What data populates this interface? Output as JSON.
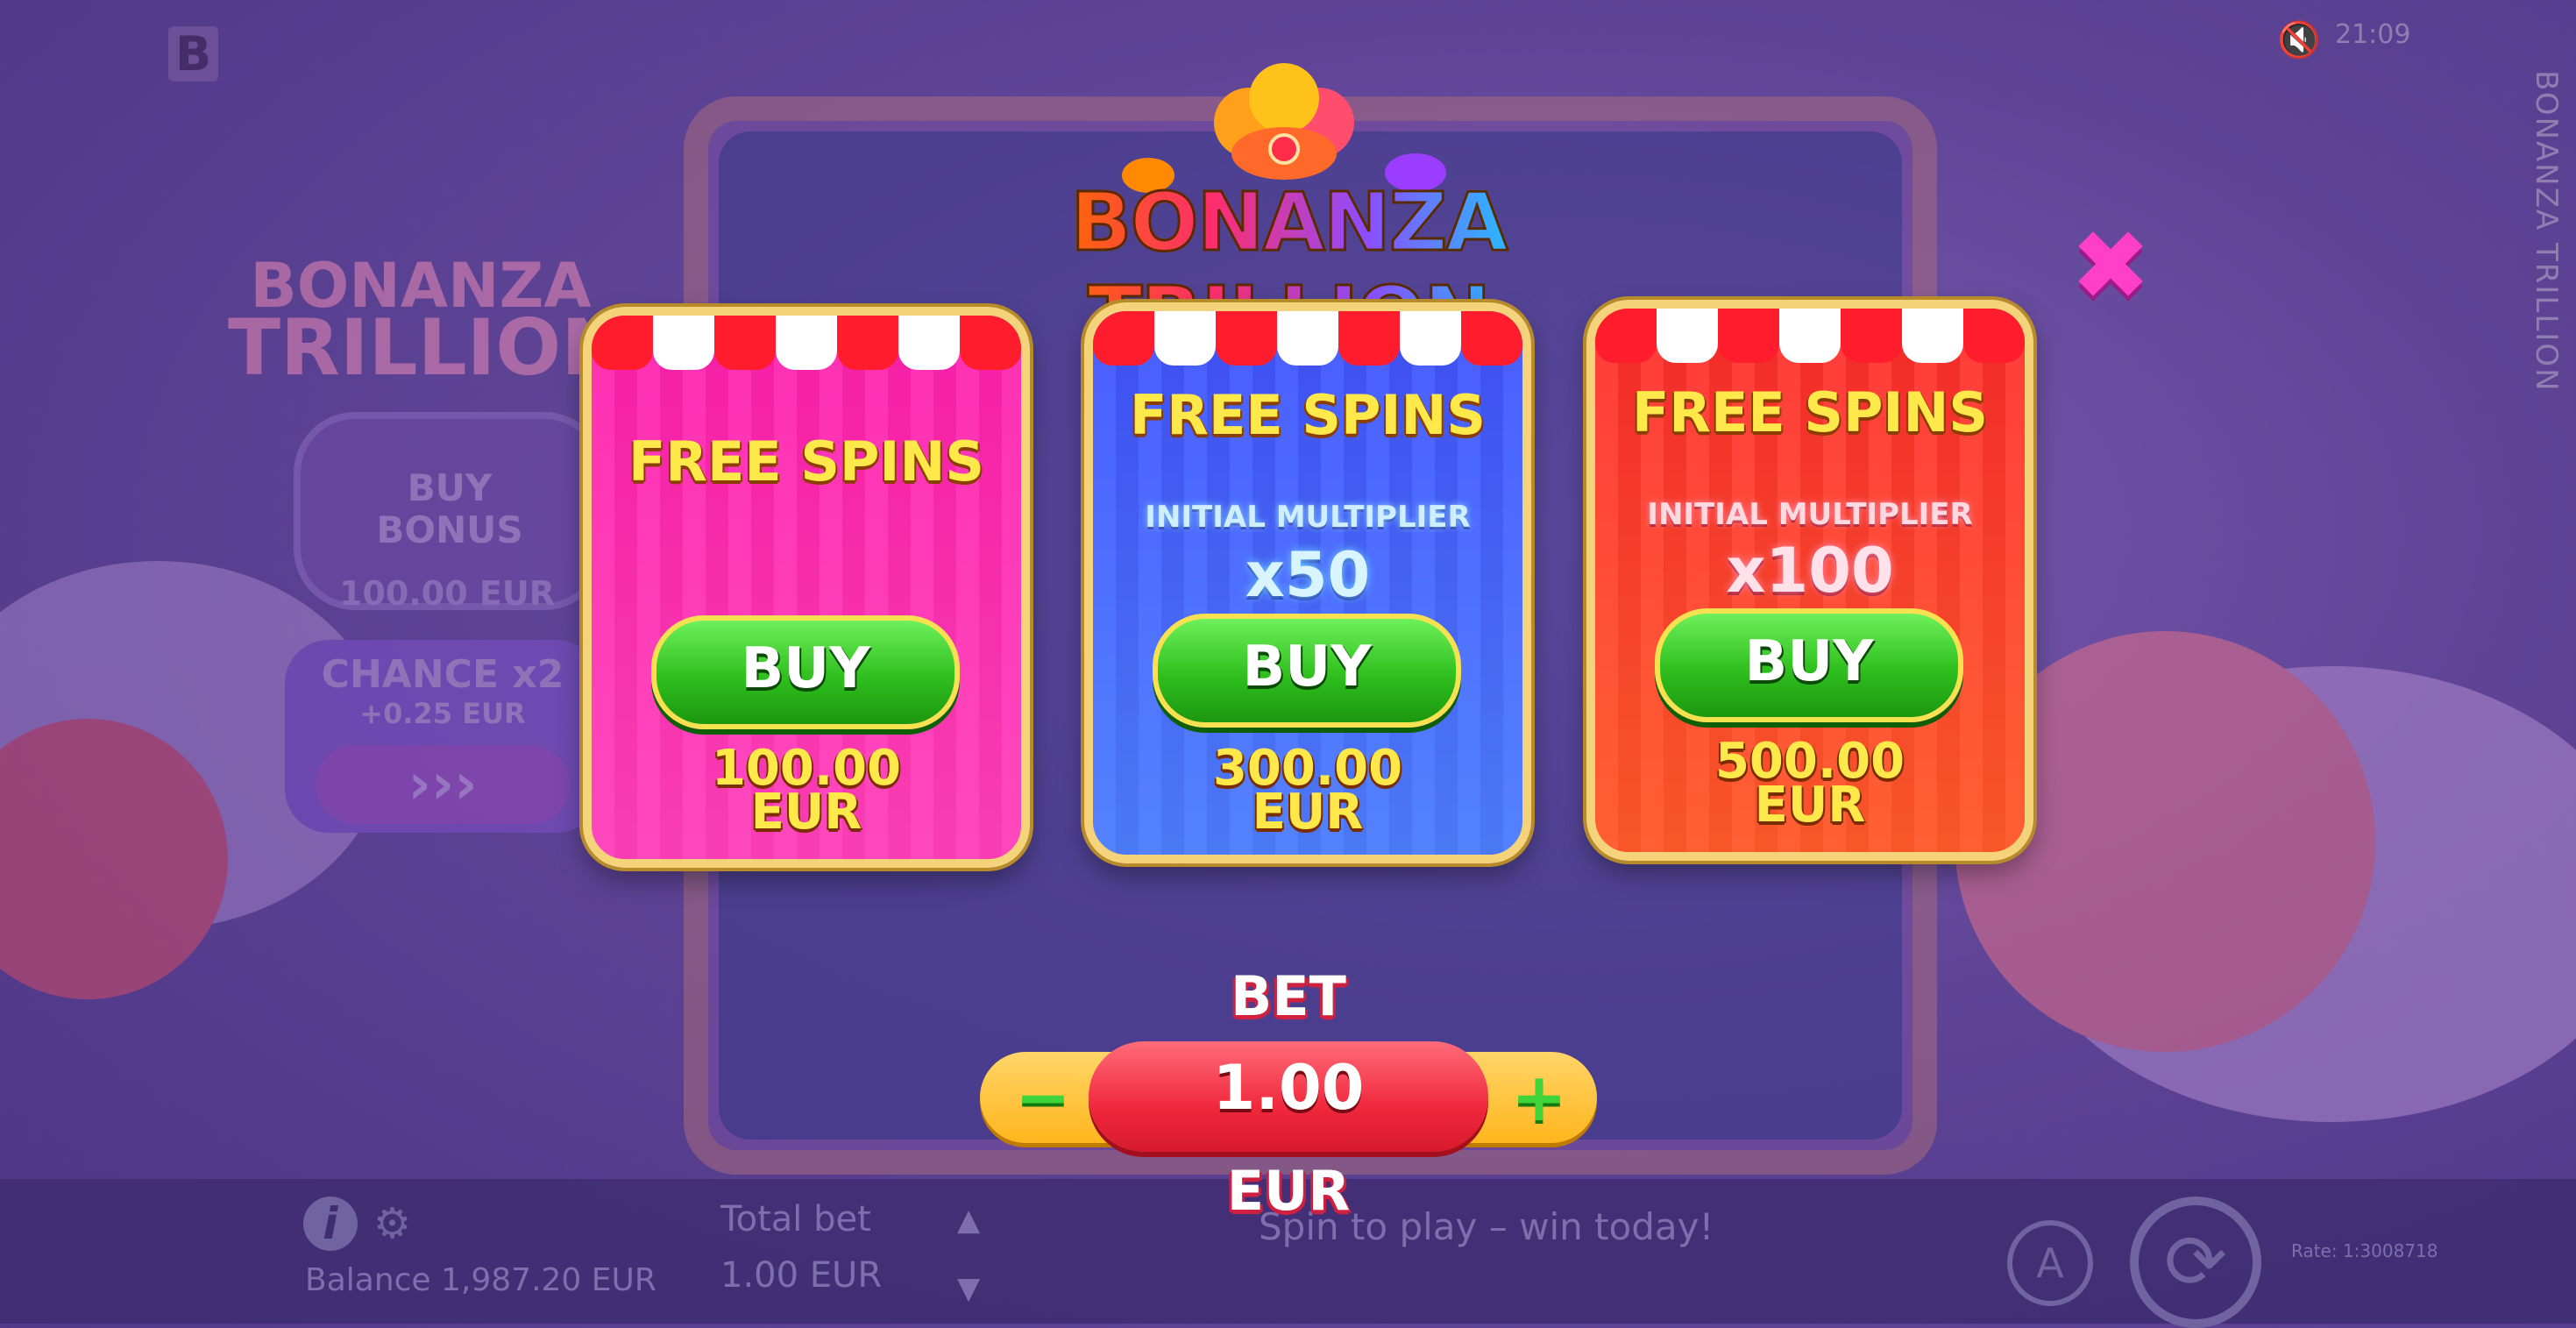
{
  "game_title": "BONANZA TRILLION",
  "side_title": "BONANZA TRILLION",
  "side_logo": {
    "line1": "BONANZA",
    "line2": "TRILLION"
  },
  "side_buy_bonus": {
    "line1": "BUY",
    "line2": "BONUS",
    "price": "100.00 EUR"
  },
  "side_chance": {
    "line1": "CHANCE x2",
    "line2": "+0.25 EUR",
    "arrow": "›››"
  },
  "top_left_logo": "B",
  "clock": "21:09",
  "cards": [
    {
      "title": "FREE SPINS",
      "buy_label": "BUY",
      "price_amount": "100.00",
      "price_currency": "EUR"
    },
    {
      "title": "FREE SPINS",
      "multiplier_label": "INITIAL MULTIPLIER",
      "multiplier_value": "x50",
      "buy_label": "BUY",
      "price_amount": "300.00",
      "price_currency": "EUR"
    },
    {
      "title": "FREE SPINS",
      "multiplier_label": "INITIAL MULTIPLIER",
      "multiplier_value": "x100",
      "buy_label": "BUY",
      "price_amount": "500.00",
      "price_currency": "EUR"
    }
  ],
  "bet": {
    "label": "BET",
    "value": "1.00",
    "currency": "EUR",
    "minus": "−",
    "plus": "+"
  },
  "bottom_bar": {
    "balance": "Balance 1,987.20 EUR",
    "total_bet_label": "Total bet",
    "total_bet_value": "1.00 EUR",
    "message": "Spin to play – win today!",
    "auto_label": "A",
    "rate": "Rate: 1:3008718"
  },
  "colors": {
    "card_pink": "#ff2fb3",
    "card_blue": "#4a5dff",
    "card_red": "#ff3b3b",
    "buy_green": "#2fbf1e",
    "title_yellow": "#ffe84a",
    "close_pink": "#ff3fc5"
  },
  "icons": [
    "close-icon",
    "info-icon",
    "gear-icon",
    "mute-icon",
    "autoplay-icon",
    "spin-icon",
    "arrow-up-icon",
    "arrow-down-icon"
  ]
}
